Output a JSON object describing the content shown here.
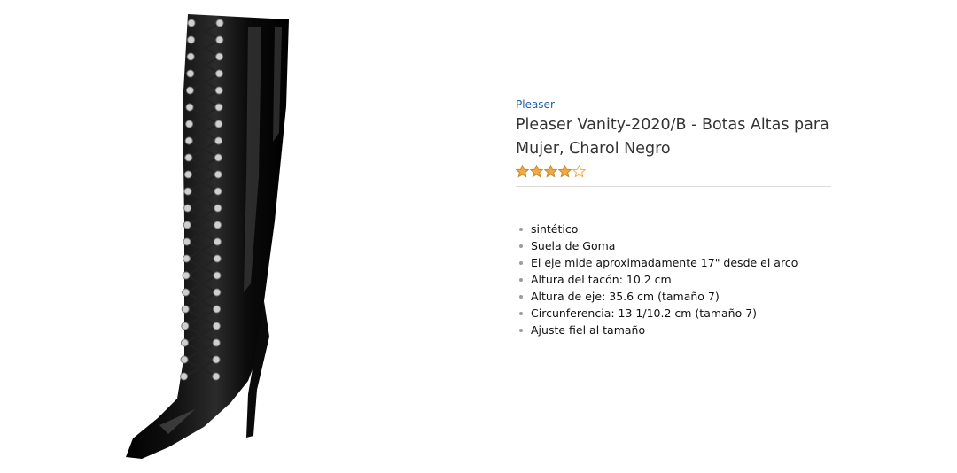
{
  "product": {
    "brand": "Pleaser",
    "title": "Pleaser Vanity-2020/B - Botas Altas para Mujer, Charol Negro",
    "rating_value": 4,
    "rating_max": 5,
    "star_color": "#f3a847",
    "bullets": [
      "sintético",
      "Suela de Goma",
      "El eje mide aproximadamente 17\" desde el arco",
      "Altura del tacón: 10.2 cm",
      "Altura de eje: 35.6 cm (tamaño 7)",
      "Circunferencia: 13 1/10.2 cm (tamaño 7)",
      "Ajuste fiel al tamaño"
    ]
  }
}
